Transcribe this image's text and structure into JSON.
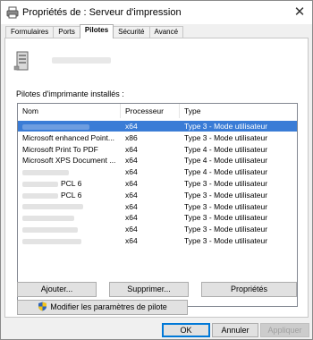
{
  "window": {
    "title": "Propriétés de : Serveur d'impression",
    "close_glyph": "✕"
  },
  "tabs": [
    {
      "label": "Formulaires"
    },
    {
      "label": "Ports"
    },
    {
      "label": "Pilotes",
      "active": true
    },
    {
      "label": "Sécurité"
    },
    {
      "label": "Avancé"
    }
  ],
  "drivers": {
    "list_label": "Pilotes d'imprimante installés :",
    "columns": {
      "name": "Nom",
      "processor": "Processeur",
      "type": "Type"
    },
    "rows": [
      {
        "name": "",
        "name_suffix": "",
        "processor": "x64",
        "type": "Type 3 - Mode utilisateur",
        "selected": true
      },
      {
        "name": "Microsoft enhanced Point...",
        "name_suffix": "",
        "processor": "x86",
        "type": "Type 3 - Mode utilisateur"
      },
      {
        "name": "Microsoft Print To PDF",
        "name_suffix": "",
        "processor": "x64",
        "type": "Type 4 - Mode utilisateur"
      },
      {
        "name": "Microsoft XPS Document ...",
        "name_suffix": "",
        "processor": "x64",
        "type": "Type 4 - Mode utilisateur"
      },
      {
        "name": "",
        "name_suffix": "",
        "processor": "x64",
        "type": "Type 4 - Mode utilisateur"
      },
      {
        "name": "",
        "name_suffix": "PCL 6",
        "processor": "x64",
        "type": "Type 3 - Mode utilisateur"
      },
      {
        "name": "",
        "name_suffix": "PCL 6",
        "processor": "x64",
        "type": "Type 3 - Mode utilisateur"
      },
      {
        "name": "",
        "name_suffix": "",
        "processor": "x64",
        "type": "Type 3 - Mode utilisateur"
      },
      {
        "name": "",
        "name_suffix": "",
        "processor": "x64",
        "type": "Type 3 - Mode utilisateur"
      },
      {
        "name": "",
        "name_suffix": "",
        "processor": "x64",
        "type": "Type 3 - Mode utilisateur"
      },
      {
        "name": "",
        "name_suffix": "",
        "processor": "x64",
        "type": "Type 3 - Mode utilisateur"
      }
    ]
  },
  "buttons": {
    "add": "Ajouter...",
    "remove": "Supprimer...",
    "properties": "Propriétés",
    "change_settings": "Modifier les paramètres de pilote",
    "ok": "OK",
    "cancel": "Annuler",
    "apply": "Appliquer"
  },
  "colors": {
    "selection": "#3a7cd6",
    "default_button_border": "#0078d7"
  }
}
